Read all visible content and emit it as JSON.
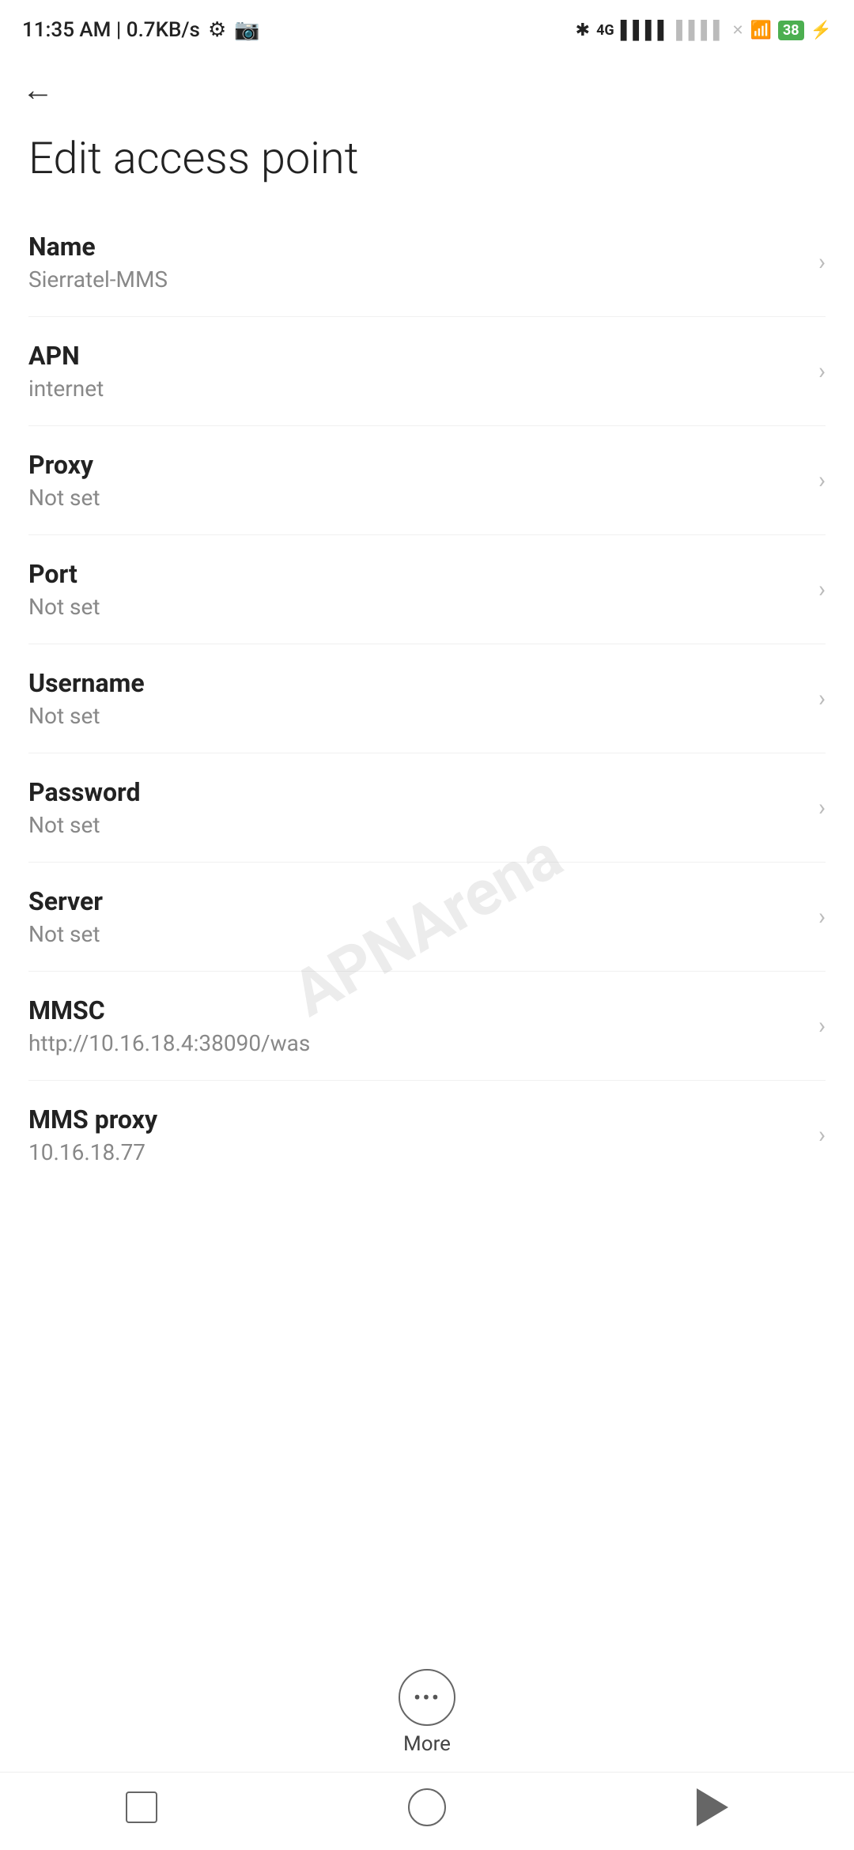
{
  "statusBar": {
    "time": "11:35 AM | 0.7KB/s",
    "batteryPercent": "38"
  },
  "header": {
    "backLabel": "←",
    "title": "Edit access point"
  },
  "settings": [
    {
      "label": "Name",
      "value": "Sierratel-MMS"
    },
    {
      "label": "APN",
      "value": "internet"
    },
    {
      "label": "Proxy",
      "value": "Not set"
    },
    {
      "label": "Port",
      "value": "Not set"
    },
    {
      "label": "Username",
      "value": "Not set"
    },
    {
      "label": "Password",
      "value": "Not set"
    },
    {
      "label": "Server",
      "value": "Not set"
    },
    {
      "label": "MMSC",
      "value": "http://10.16.18.4:38090/was"
    },
    {
      "label": "MMS proxy",
      "value": "10.16.18.77"
    }
  ],
  "more": {
    "label": "More"
  },
  "watermark": "APNArena"
}
